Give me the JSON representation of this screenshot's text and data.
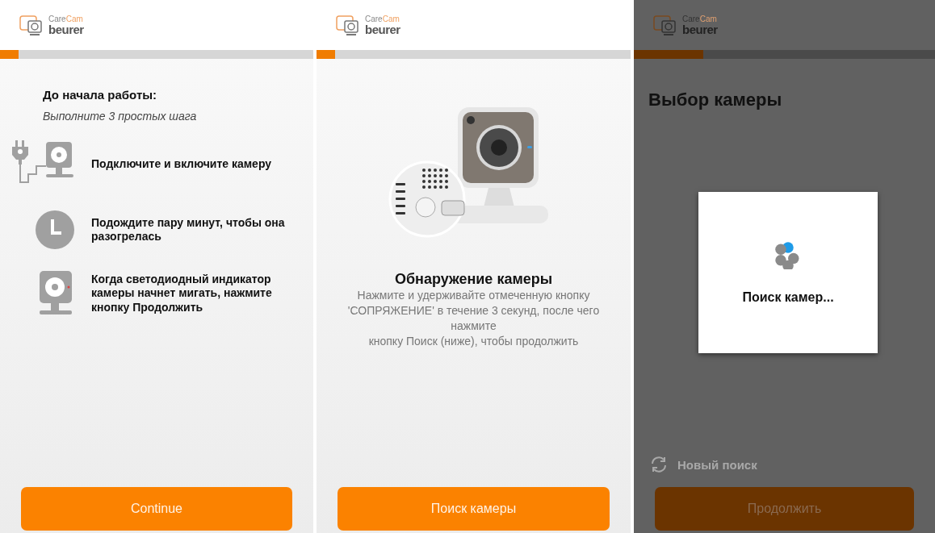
{
  "screens": [
    {
      "kind": "steps",
      "dimmed": false,
      "logo": {
        "care": "Care",
        "cam": "Cam",
        "brand": "beurer"
      },
      "progress": {
        "level": 0.06
      },
      "title": "До начала работы:",
      "subtitle": "Выполните 3 простых шага",
      "steps": [
        {
          "kind": "plug",
          "text": "Подключите и включите камеру"
        },
        {
          "kind": "clock",
          "text": "Подождите пару минут, чтобы она разогрелась"
        },
        {
          "kind": "camera",
          "text": "Когда светодиодный индикатор камеры начнет мигать, нажмите кнопку Продолжить"
        }
      ],
      "button": "Continue"
    },
    {
      "kind": "pairing",
      "dimmed": false,
      "logo": {
        "care": "Care",
        "cam": "Cam",
        "brand": "beurer"
      },
      "progress": {
        "level": 0.06
      },
      "title": "Обнаружение камеры",
      "description": [
        "Нажмите и удерживайте отмеченную кнопку 'СОПРЯЖЕНИЕ' в течение 3 секунд, после чего нажмите",
        "кнопку Поиск (ниже), чтобы продолжить"
      ],
      "button": "Поиск камеры"
    },
    {
      "kind": "search",
      "dimmed": true,
      "logo": {
        "care": "Care",
        "cam": "Cam",
        "brand": "beurer"
      },
      "progress": {
        "level": 0.23
      },
      "title": "Выбор камеры",
      "new_search": "Новый поиск",
      "button": "Продолжить",
      "dialog": {
        "message": "Поиск камер..."
      }
    }
  ]
}
